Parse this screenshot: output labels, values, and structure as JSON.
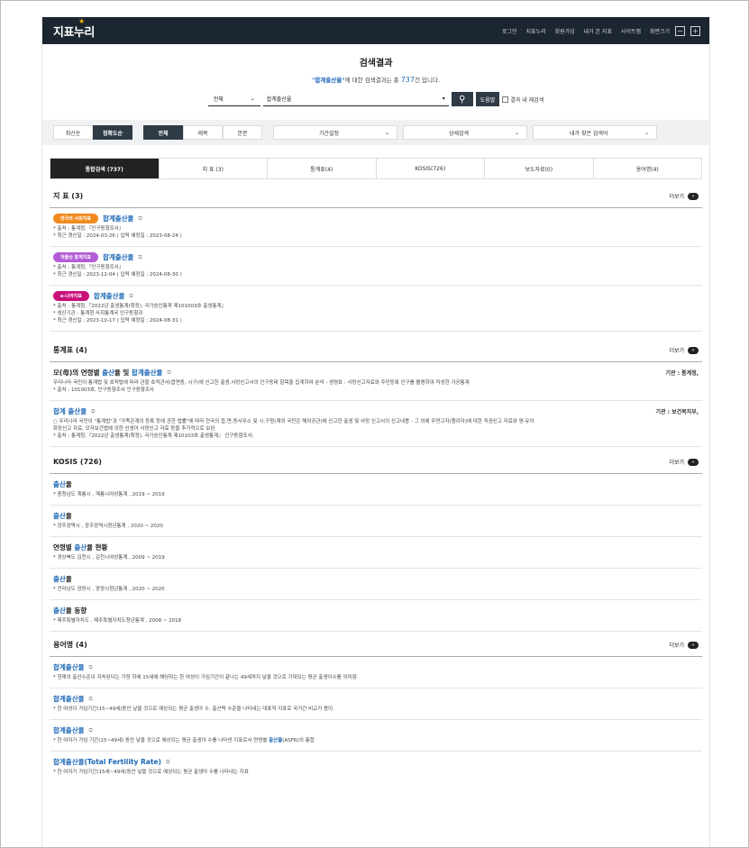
{
  "logo": "지표누리",
  "topmenu": [
    "로그인",
    "지표누리",
    "회원가입",
    "내가 본 지표",
    "사이트맵",
    "화면크기"
  ],
  "search": {
    "title": "검색결과",
    "keyword": "\"합계출산율\"",
    "summary_mid": "에 대한 검색결과는 총 ",
    "count": "737",
    "summary_end": "건 입니다.",
    "scope": "전체",
    "query": "합계출산율",
    "help": "도움말",
    "within": "결과 내 재검색"
  },
  "filters": {
    "sort": [
      "최신순",
      "정확도순"
    ],
    "field": [
      "전체",
      "제목",
      "본문"
    ],
    "dropdowns": [
      "기간설정",
      "상세검색",
      "내가 찾은 검색어"
    ]
  },
  "tabs": [
    "통합검색 (737)",
    "지 표 (3)",
    "통계표(4)",
    "KOSIS(726)",
    "보도자료(0)",
    "용어명(4)"
  ],
  "more_label": "더보기",
  "indicators": {
    "title": "지 표 (3)",
    "items": [
      {
        "badge": "한국의 사회지표",
        "badge_color": "#f08a1c",
        "name": "합계출산율",
        "lines": [
          "* 출처 : 통계청,『인구동향조사』",
          "* 최근 갱신일 : 2024-03-26 ( 입력 예정일 : 2023-08-24 )"
        ]
      },
      {
        "badge": "저출산 통계지표",
        "badge_color": "#b25cd6",
        "name": "합계출산율",
        "lines": [
          "* 출처 : 통계청,『인구동향조사』",
          "* 최근 갱신일 : 2023-12-04 ( 입력 예정일 : 2024-08-30 )"
        ]
      },
      {
        "badge": "e-나라지표",
        "badge_color": "#c8107a",
        "name": "합계출산율",
        "lines": [
          "* 출처 : 통계청,『2022년 출생통계(확정), 국가승인통계 제101003호 출생통계』",
          "* 생산기관 : 통계청 사회통계국 인구동향과",
          "* 최근 갱신일 : 2023-10-17 ( 입력 예정일 : 2024-08-31 )"
        ]
      }
    ]
  },
  "tables": {
    "title": "통계표 (4)",
    "items": [
      {
        "p1": "모(母)의 연령별 ",
        "h1": "출산",
        "p2": "율 및 ",
        "h2": "합계출산율",
        "agency": "기관 : 통계청,",
        "lines": [
          "우리나라 국민이 통계법 및 호적법에 따라 관할 호적관서(읍면동, 시구)에 신고한 출생.사망신고서의 인구동태 항목을 집계하여 분석 - 생명표 : 사망신고자료와 주민등록 인구를 활용하여 작성한 가공통계",
          "* 출처 : 101003호, 인구동향조사 인구동향조사"
        ]
      },
      {
        "p1": "",
        "h1": "합계 출산율",
        "p2": "",
        "h2": "",
        "agency": "기관 : 보건복지부,",
        "lines": [
          "○ 우리나라 국민이 \"통계법\"과 \"가족관계의 등록 등에 관한 법률\"에 따라 전국의 읍,면,동사무소 및 시,구청(재외 국민은 해외공관)에 신고한 출생 및 사망 신고서의 신고내용 - 그 외에 무연고자(행려자)에 대한 직권신고 자료와 영·유아",
          "화장신고 자료, 모자보건법에 의한 신생아 사망신고 자료 등을 추가적으로 보완",
          "* 출처 : 통계청,『2022년 출생통계(확정), 국가승인통계 제10103호 출생통계』 인구동향조사;"
        ]
      }
    ]
  },
  "kosis": {
    "title": "KOSIS (726)",
    "items": [
      {
        "h": "출산",
        "p": "율",
        "line": "* 충청남도 계룡시 , 계룡시여성통계 , 2019 ~ 2019"
      },
      {
        "h": "출산",
        "p": "율",
        "line": "* 광주광역시 , 광주광역시청년통계 , 2020 ~ 2020"
      },
      {
        "pre": "연령별 ",
        "h": "출산",
        "p": "율 현황",
        "line": "* 경상북도 김천시 , 김천시여성통계 , 2009 ~ 2019"
      },
      {
        "h": "출산",
        "p": "율",
        "line": "* 전라남도 광양시 , 광양시청년통계 , 2020 ~ 2020"
      },
      {
        "h": "출산",
        "p": "율 동향",
        "line": "* 제주특별자치도 , 제주특별자치도청년통계 , 2008 ~ 2018"
      }
    ]
  },
  "terms": {
    "title": "용어명 (4)",
    "items": [
      {
        "name": "합계출산율",
        "line": "* 현재의 출산수준이 지속된다는 가정 하에 15세에 해당하는 한 여성이 가임기간이 끝나는 49세까지 낳을 것으로 기대되는 평균 출생아수를 의미함."
      },
      {
        "name": "합계출산율",
        "line": "* 한 여성이 가임기간(15~49세)동안 낳을 것으로 예상되는 평균 출생아 수. 출산력 수준을 나타내는 대표적 지표로 국가간 비교가 용이."
      },
      {
        "name": "합계출산율",
        "line": "* 한 여자가 가임 기간(15~49세) 동안 낳을 것으로 예상되는 평균 출생아 수를 나타낸 지표로서 연령별 ",
        "line_hl": "출산율",
        "line_end": "(ASFR)의 총합"
      },
      {
        "name": "합계출산율(Total Fertility Rate)",
        "line": "* 한 여자가 가임기간(15세~49세)동안 낳을 것으로 예상되는 평균 출생아 수를 나타내는 지표"
      }
    ]
  }
}
